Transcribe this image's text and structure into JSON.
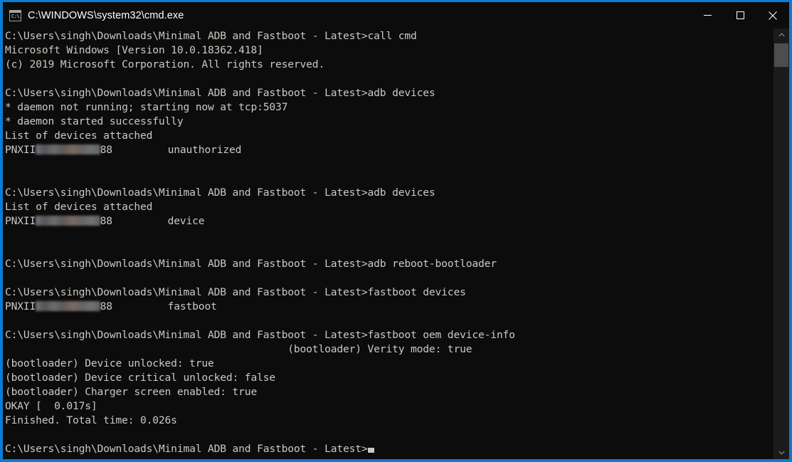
{
  "window": {
    "title": "C:\\WINDOWS\\system32\\cmd.exe",
    "icon": "cmd-console-icon",
    "icon_glyph": "C:\\.",
    "active_border_color": "#0a7cd5",
    "background_color": "#0c0c0c",
    "text_color": "#ccc9c3"
  },
  "caption": {
    "minimize_label": "Minimize",
    "maximize_label": "Maximize",
    "close_label": "Close"
  },
  "scrollbar": {
    "up_arrow_label": "Scroll up",
    "down_arrow_label": "Scroll down",
    "thumb_label": "Scroll thumb"
  },
  "console": {
    "prompt": "C:\\Users\\singh\\Downloads\\Minimal ADB and Fastboot - Latest>",
    "lines": [
      {
        "type": "prompt",
        "prompt": "C:\\Users\\singh\\Downloads\\Minimal ADB and Fastboot - Latest>",
        "command": "call cmd"
      },
      {
        "type": "text",
        "text": "Microsoft Windows [Version 10.0.18362.418]"
      },
      {
        "type": "text",
        "text": "(c) 2019 Microsoft Corporation. All rights reserved."
      },
      {
        "type": "text",
        "text": ""
      },
      {
        "type": "prompt",
        "prompt": "C:\\Users\\singh\\Downloads\\Minimal ADB and Fastboot - Latest>",
        "command": "adb devices"
      },
      {
        "type": "text",
        "text": "* daemon not running; starting now at tcp:5037"
      },
      {
        "type": "text",
        "text": "* daemon started successfully"
      },
      {
        "type": "text",
        "text": "List of devices attached"
      },
      {
        "type": "device",
        "prefix": "PNXII",
        "redacted": true,
        "suffix": "88",
        "gap": "         ",
        "status": "unauthorized"
      },
      {
        "type": "text",
        "text": ""
      },
      {
        "type": "text",
        "text": ""
      },
      {
        "type": "prompt",
        "prompt": "C:\\Users\\singh\\Downloads\\Minimal ADB and Fastboot - Latest>",
        "command": "adb devices"
      },
      {
        "type": "text",
        "text": "List of devices attached"
      },
      {
        "type": "device",
        "prefix": "PNXII",
        "redacted": true,
        "suffix": "88",
        "gap": "         ",
        "status": "device"
      },
      {
        "type": "text",
        "text": ""
      },
      {
        "type": "text",
        "text": ""
      },
      {
        "type": "prompt",
        "prompt": "C:\\Users\\singh\\Downloads\\Minimal ADB and Fastboot - Latest>",
        "command": "adb reboot-bootloader"
      },
      {
        "type": "text",
        "text": ""
      },
      {
        "type": "prompt",
        "prompt": "C:\\Users\\singh\\Downloads\\Minimal ADB and Fastboot - Latest>",
        "command": "fastboot devices"
      },
      {
        "type": "device",
        "prefix": "PNXII",
        "redacted": true,
        "suffix": "88",
        "gap": "         ",
        "status": "fastboot"
      },
      {
        "type": "text",
        "text": ""
      },
      {
        "type": "prompt",
        "prompt": "C:\\Users\\singh\\Downloads\\Minimal ADB and Fastboot - Latest>",
        "command": "fastboot oem device-info"
      },
      {
        "type": "text",
        "text": "                                              (bootloader) Verity mode: true"
      },
      {
        "type": "text",
        "text": "(bootloader) Device unlocked: true"
      },
      {
        "type": "text",
        "text": "(bootloader) Device critical unlocked: false"
      },
      {
        "type": "text",
        "text": "(bootloader) Charger screen enabled: true"
      },
      {
        "type": "text",
        "text": "OKAY [  0.017s]"
      },
      {
        "type": "text",
        "text": "Finished. Total time: 0.026s"
      },
      {
        "type": "text",
        "text": ""
      },
      {
        "type": "cursor-prompt",
        "prompt": "C:\\Users\\singh\\Downloads\\Minimal ADB and Fastboot - Latest>"
      }
    ]
  }
}
